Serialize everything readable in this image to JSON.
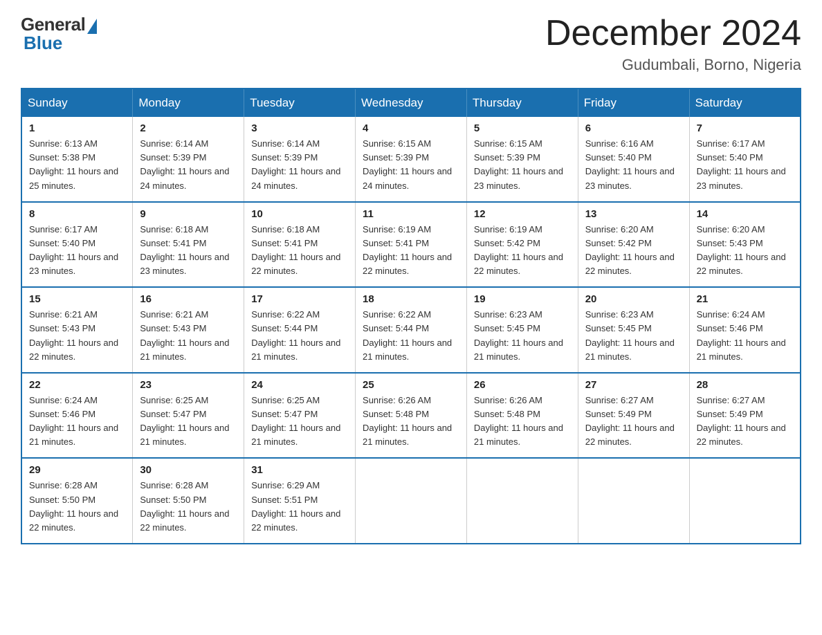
{
  "header": {
    "logo_general": "General",
    "logo_blue": "Blue",
    "month_title": "December 2024",
    "location": "Gudumbali, Borno, Nigeria"
  },
  "days_of_week": [
    "Sunday",
    "Monday",
    "Tuesday",
    "Wednesday",
    "Thursday",
    "Friday",
    "Saturday"
  ],
  "weeks": [
    [
      {
        "day": "1",
        "sunrise": "6:13 AM",
        "sunset": "5:38 PM",
        "daylight": "11 hours and 25 minutes."
      },
      {
        "day": "2",
        "sunrise": "6:14 AM",
        "sunset": "5:39 PM",
        "daylight": "11 hours and 24 minutes."
      },
      {
        "day": "3",
        "sunrise": "6:14 AM",
        "sunset": "5:39 PM",
        "daylight": "11 hours and 24 minutes."
      },
      {
        "day": "4",
        "sunrise": "6:15 AM",
        "sunset": "5:39 PM",
        "daylight": "11 hours and 24 minutes."
      },
      {
        "day": "5",
        "sunrise": "6:15 AM",
        "sunset": "5:39 PM",
        "daylight": "11 hours and 23 minutes."
      },
      {
        "day": "6",
        "sunrise": "6:16 AM",
        "sunset": "5:40 PM",
        "daylight": "11 hours and 23 minutes."
      },
      {
        "day": "7",
        "sunrise": "6:17 AM",
        "sunset": "5:40 PM",
        "daylight": "11 hours and 23 minutes."
      }
    ],
    [
      {
        "day": "8",
        "sunrise": "6:17 AM",
        "sunset": "5:40 PM",
        "daylight": "11 hours and 23 minutes."
      },
      {
        "day": "9",
        "sunrise": "6:18 AM",
        "sunset": "5:41 PM",
        "daylight": "11 hours and 23 minutes."
      },
      {
        "day": "10",
        "sunrise": "6:18 AM",
        "sunset": "5:41 PM",
        "daylight": "11 hours and 22 minutes."
      },
      {
        "day": "11",
        "sunrise": "6:19 AM",
        "sunset": "5:41 PM",
        "daylight": "11 hours and 22 minutes."
      },
      {
        "day": "12",
        "sunrise": "6:19 AM",
        "sunset": "5:42 PM",
        "daylight": "11 hours and 22 minutes."
      },
      {
        "day": "13",
        "sunrise": "6:20 AM",
        "sunset": "5:42 PM",
        "daylight": "11 hours and 22 minutes."
      },
      {
        "day": "14",
        "sunrise": "6:20 AM",
        "sunset": "5:43 PM",
        "daylight": "11 hours and 22 minutes."
      }
    ],
    [
      {
        "day": "15",
        "sunrise": "6:21 AM",
        "sunset": "5:43 PM",
        "daylight": "11 hours and 22 minutes."
      },
      {
        "day": "16",
        "sunrise": "6:21 AM",
        "sunset": "5:43 PM",
        "daylight": "11 hours and 21 minutes."
      },
      {
        "day": "17",
        "sunrise": "6:22 AM",
        "sunset": "5:44 PM",
        "daylight": "11 hours and 21 minutes."
      },
      {
        "day": "18",
        "sunrise": "6:22 AM",
        "sunset": "5:44 PM",
        "daylight": "11 hours and 21 minutes."
      },
      {
        "day": "19",
        "sunrise": "6:23 AM",
        "sunset": "5:45 PM",
        "daylight": "11 hours and 21 minutes."
      },
      {
        "day": "20",
        "sunrise": "6:23 AM",
        "sunset": "5:45 PM",
        "daylight": "11 hours and 21 minutes."
      },
      {
        "day": "21",
        "sunrise": "6:24 AM",
        "sunset": "5:46 PM",
        "daylight": "11 hours and 21 minutes."
      }
    ],
    [
      {
        "day": "22",
        "sunrise": "6:24 AM",
        "sunset": "5:46 PM",
        "daylight": "11 hours and 21 minutes."
      },
      {
        "day": "23",
        "sunrise": "6:25 AM",
        "sunset": "5:47 PM",
        "daylight": "11 hours and 21 minutes."
      },
      {
        "day": "24",
        "sunrise": "6:25 AM",
        "sunset": "5:47 PM",
        "daylight": "11 hours and 21 minutes."
      },
      {
        "day": "25",
        "sunrise": "6:26 AM",
        "sunset": "5:48 PM",
        "daylight": "11 hours and 21 minutes."
      },
      {
        "day": "26",
        "sunrise": "6:26 AM",
        "sunset": "5:48 PM",
        "daylight": "11 hours and 21 minutes."
      },
      {
        "day": "27",
        "sunrise": "6:27 AM",
        "sunset": "5:49 PM",
        "daylight": "11 hours and 22 minutes."
      },
      {
        "day": "28",
        "sunrise": "6:27 AM",
        "sunset": "5:49 PM",
        "daylight": "11 hours and 22 minutes."
      }
    ],
    [
      {
        "day": "29",
        "sunrise": "6:28 AM",
        "sunset": "5:50 PM",
        "daylight": "11 hours and 22 minutes."
      },
      {
        "day": "30",
        "sunrise": "6:28 AM",
        "sunset": "5:50 PM",
        "daylight": "11 hours and 22 minutes."
      },
      {
        "day": "31",
        "sunrise": "6:29 AM",
        "sunset": "5:51 PM",
        "daylight": "11 hours and 22 minutes."
      },
      null,
      null,
      null,
      null
    ]
  ],
  "labels": {
    "sunrise_prefix": "Sunrise: ",
    "sunset_prefix": "Sunset: ",
    "daylight_prefix": "Daylight: "
  }
}
